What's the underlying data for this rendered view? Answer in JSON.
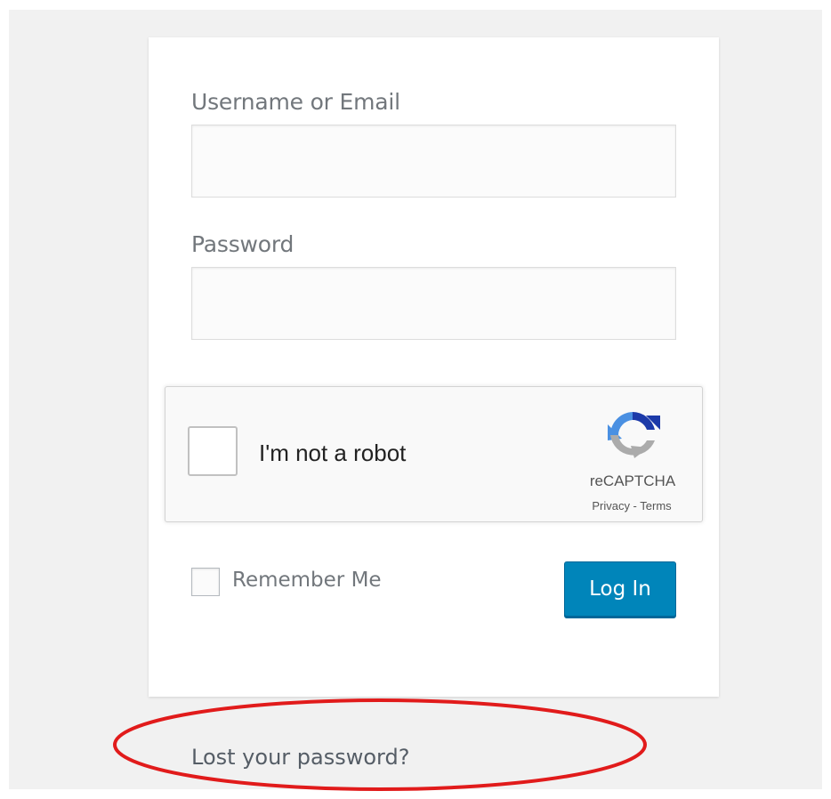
{
  "form": {
    "username_label": "Username or Email",
    "username_value": "",
    "password_label": "Password",
    "password_value": "",
    "remember_label": "Remember Me",
    "remember_checked": false,
    "login_label": "Log In",
    "lost_password_label": "Lost your password?"
  },
  "recaptcha": {
    "checkbox_label": "I'm not a robot",
    "brand": "reCAPTCHA",
    "links": "Privacy - Terms",
    "icon": "recaptcha-logo-icon"
  },
  "colors": {
    "background": "#f1f1f1",
    "card": "#ffffff",
    "button": "#0085ba",
    "label": "#72777c",
    "highlight": "#e11b1b"
  }
}
